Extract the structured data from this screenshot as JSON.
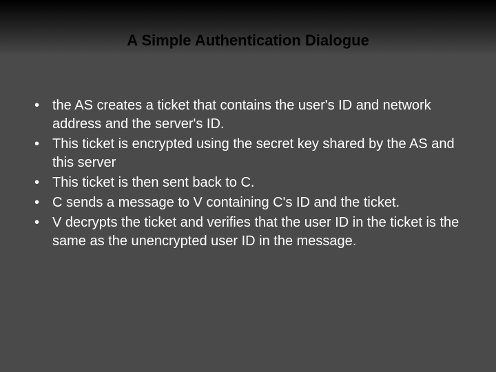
{
  "title": "A Simple Authentication Dialogue",
  "bullets": [
    "the AS creates a ticket that contains the user's ID and network address and the server's ID.",
    "This ticket is encrypted using the secret key shared by the AS and this server",
    "This ticket is then sent back to C.",
    "C sends a message to V containing C's ID and the ticket.",
    "V decrypts the ticket and verifies that the user ID in the ticket is the same as the unencrypted user ID in the message."
  ]
}
